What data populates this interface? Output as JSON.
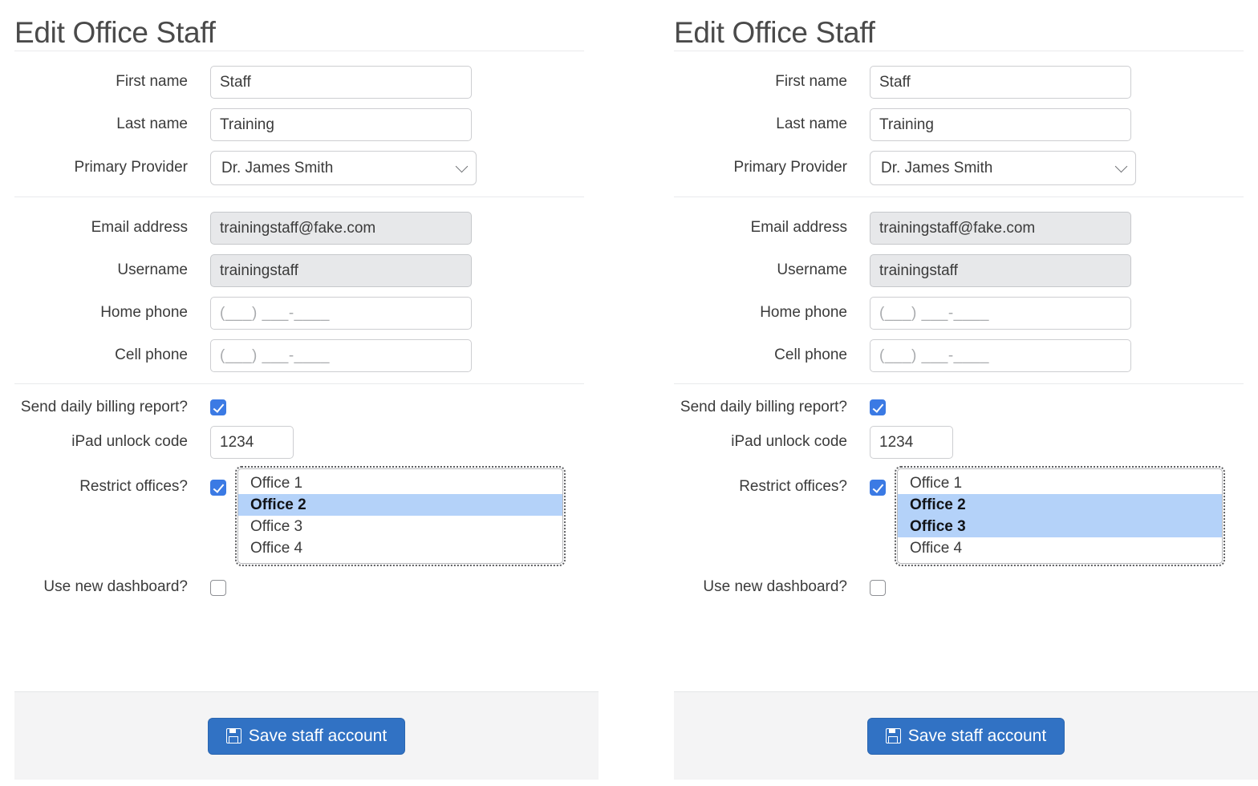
{
  "colors": {
    "accent_blue": "#3b7ae4",
    "button_blue": "#3172c4",
    "selection_blue": "#b4d2f9",
    "footer_gray": "#f4f4f5",
    "disabled_gray": "#e7e8ea"
  },
  "panels": [
    {
      "id": "left",
      "title": "Edit Office Staff",
      "identity": {
        "first_name": {
          "label": "First name",
          "value": "Staff"
        },
        "last_name": {
          "label": "Last name",
          "value": "Training"
        },
        "primary_provider": {
          "label": "Primary Provider",
          "value": "Dr. James Smith"
        }
      },
      "contact": {
        "email": {
          "label": "Email address",
          "value": "trainingstaff@fake.com",
          "disabled": true
        },
        "username": {
          "label": "Username",
          "value": "trainingstaff",
          "disabled": true
        },
        "home_phone": {
          "label": "Home phone",
          "value": "",
          "placeholder": "(___) ___-____"
        },
        "cell_phone": {
          "label": "Cell phone",
          "value": "",
          "placeholder": "(___) ___-____"
        }
      },
      "options": {
        "daily_billing": {
          "label": "Send daily billing report?",
          "checked": true
        },
        "ipad_code": {
          "label": "iPad unlock code",
          "value": "1234"
        },
        "restrict_offices": {
          "label": "Restrict offices?",
          "checked": true
        },
        "offices": [
          "Office 1",
          "Office 2",
          "Office 3",
          "Office 4"
        ],
        "offices_selected": [
          "Office 2"
        ],
        "new_dashboard": {
          "label": "Use new dashboard?",
          "checked": false
        }
      },
      "footer": {
        "save_label": "Save staff account",
        "save_icon": "floppy-disk-icon"
      }
    },
    {
      "id": "right",
      "title": "Edit Office Staff",
      "identity": {
        "first_name": {
          "label": "First name",
          "value": "Staff"
        },
        "last_name": {
          "label": "Last name",
          "value": "Training"
        },
        "primary_provider": {
          "label": "Primary Provider",
          "value": "Dr. James Smith"
        }
      },
      "contact": {
        "email": {
          "label": "Email address",
          "value": "trainingstaff@fake.com",
          "disabled": true
        },
        "username": {
          "label": "Username",
          "value": "trainingstaff",
          "disabled": true
        },
        "home_phone": {
          "label": "Home phone",
          "value": "",
          "placeholder": "(___) ___-____"
        },
        "cell_phone": {
          "label": "Cell phone",
          "value": "",
          "placeholder": "(___) ___-____"
        }
      },
      "options": {
        "daily_billing": {
          "label": "Send daily billing report?",
          "checked": true
        },
        "ipad_code": {
          "label": "iPad unlock code",
          "value": "1234"
        },
        "restrict_offices": {
          "label": "Restrict offices?",
          "checked": true
        },
        "offices": [
          "Office 1",
          "Office 2",
          "Office 3",
          "Office 4"
        ],
        "offices_selected": [
          "Office 2",
          "Office 3"
        ],
        "new_dashboard": {
          "label": "Use new dashboard?",
          "checked": false
        }
      },
      "footer": {
        "save_label": "Save staff account",
        "save_icon": "floppy-disk-icon"
      }
    }
  ]
}
